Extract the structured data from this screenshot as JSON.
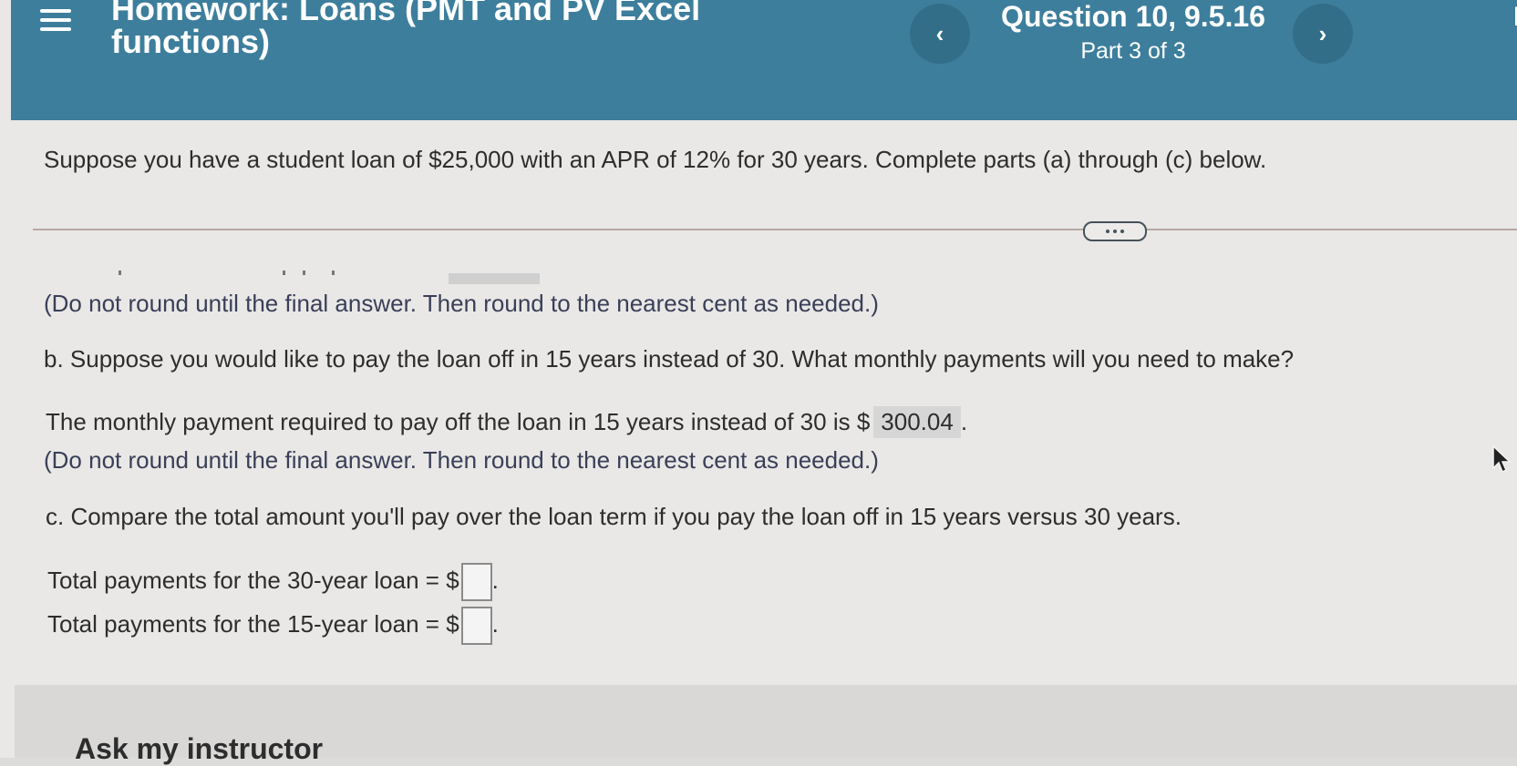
{
  "header": {
    "title": "Homework: Loans (PMT and PV Excel functions)",
    "question": "Question 10, 9.5.16",
    "part": "Part 3 of 3",
    "prev_label": "‹",
    "next_label": "›",
    "edge_letter": "H",
    "menu_icon": "hamburger-menu-icon"
  },
  "colors": {
    "header_bg": "#3d7e9c",
    "nav_button_bg": "#336e89",
    "page_bg": "#e9e8e6"
  },
  "problem": {
    "intro": "Suppose you have a student loan of $25,000 with an APR of 12% for 30 years. Complete parts (a) through (c) below.",
    "note_a": "(Do not round until the final answer. Then round to the nearest cent as needed.)",
    "part_b_question": "b. Suppose you would like to pay the loan off in 15 years instead of 30. What monthly payments will you need to make?",
    "part_b_answer_prefix": "The monthly payment required to pay off the loan in 15 years instead of 30 is $",
    "part_b_answer_value": "300.04",
    "part_b_answer_suffix": ".",
    "note_b": "(Do not round until the final answer. Then round to the nearest cent as needed.)",
    "part_c_question": "c. Compare the total amount you'll pay over the loan term if you pay the loan off in 15 years  versus 30 years.",
    "total_30_label": "Total payments for the 30-year loan = $",
    "total_30_value": "",
    "total_15_label": "Total payments for the 15-year loan = $",
    "total_15_value": "",
    "period": "."
  },
  "footer": {
    "ask_instructor": "Ask my instructor"
  }
}
